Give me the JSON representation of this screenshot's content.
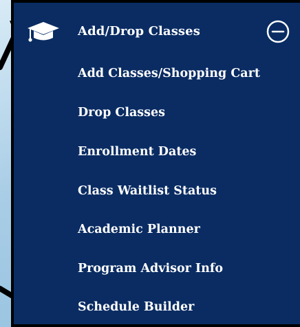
{
  "menu": {
    "header_label": "Add/Drop Classes",
    "header_icon": "graduation-cap-icon",
    "toggle_icon": "collapse-minus-icon",
    "items": [
      {
        "label": "Add Classes/Shopping Cart"
      },
      {
        "label": "Drop Classes"
      },
      {
        "label": "Enrollment Dates"
      },
      {
        "label": "Class Waitlist Status"
      },
      {
        "label": "Academic Planner"
      },
      {
        "label": "Program Advisor Info"
      },
      {
        "label": "Schedule Builder"
      }
    ]
  },
  "colors": {
    "panel_background": "#0a2c63",
    "text": "#ffffff",
    "border": "#000000",
    "page_background": "#bcd9ec"
  }
}
